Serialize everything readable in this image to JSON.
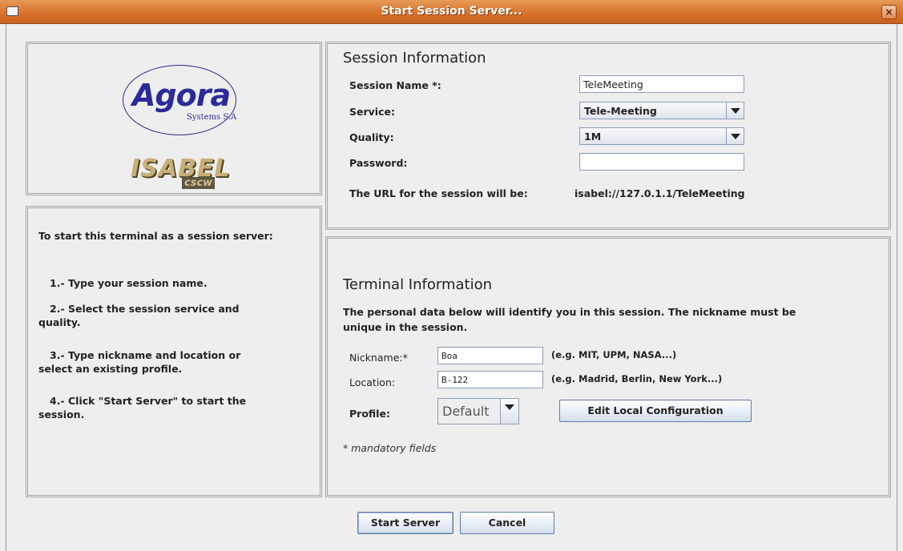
{
  "window": {
    "title": "Start Session Server...",
    "close_glyph": "×"
  },
  "logo": {
    "agora_text": "Agora",
    "agora_sub": "Systems S.A",
    "isabel_text": "ISABEL",
    "cscw_text": "cscw"
  },
  "instructions": {
    "heading": "To start this terminal as a session server:",
    "steps": [
      "1.- Type your session name.",
      "2.- Select the session service and",
      "quality.",
      "3.- Type nickname and location or",
      "select an existing profile.",
      "4.- Click \"Start Server\" to start the",
      "session."
    ]
  },
  "session": {
    "title": "Session Information",
    "name_label": "Session Name *:",
    "name_value": "TeleMeeting",
    "service_label": "Service:",
    "service_value": "Tele-Meeting",
    "quality_label": "Quality:",
    "quality_value": "1M",
    "password_label": "Password:",
    "password_value": "",
    "url_label": "The URL for the session will be:",
    "url_value": "isabel://127.0.1.1/TeleMeeting"
  },
  "terminal": {
    "title": "Terminal Information",
    "description_line1": "The personal data below will identify you in this session. The nickname must be",
    "description_line2": "unique in the session.",
    "nickname_label": "Nickname:*",
    "nickname_value": "Boa",
    "nickname_hint": "(e.g. MIT, UPM, NASA...)",
    "location_label": "Location:",
    "location_value": "B-122",
    "location_hint": "(e.g. Madrid, Berlin, New York...)",
    "profile_label": "Profile:",
    "profile_value": "Default",
    "edit_config_label": "Edit Local Configuration",
    "mandatory_note": "* mandatory fields"
  },
  "footer": {
    "start_label": "Start Server",
    "cancel_label": "Cancel"
  }
}
